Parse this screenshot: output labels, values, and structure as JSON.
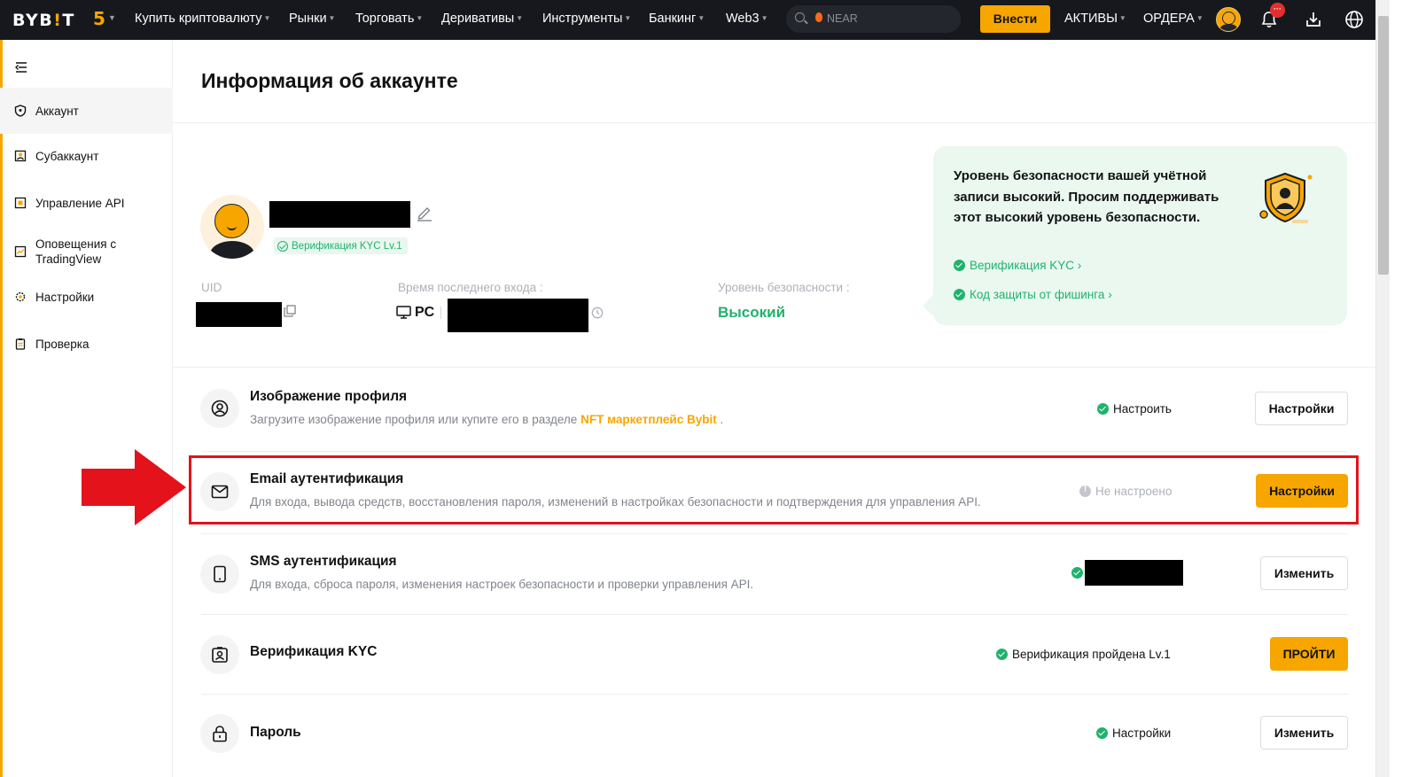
{
  "topbar": {
    "logo_text": "BYB",
    "logo_bang": "!",
    "logo_tail": "T",
    "anniversary": "5",
    "nav": [
      {
        "label": "Купить криптовалюту"
      },
      {
        "label": "Рынки"
      },
      {
        "label": "Торговать"
      },
      {
        "label": "Деривативы"
      },
      {
        "label": "Инструменты"
      },
      {
        "label": "Банкинг"
      },
      {
        "label": "Web3"
      }
    ],
    "search_placeholder": "NEAR",
    "deposit_label": "Внести",
    "assets_label": "АКТИВЫ",
    "orders_label": "ОРДЕРА",
    "notification_badge": "···"
  },
  "sidebar": {
    "items": [
      {
        "label": "Аккаунт",
        "icon": "shield-icon"
      },
      {
        "label": "Субаккаунт",
        "icon": "subaccount-icon"
      },
      {
        "label": "Управление API",
        "icon": "api-icon"
      },
      {
        "label": "Оповещения с TradingView",
        "icon": "tradingview-icon"
      },
      {
        "label": "Настройки",
        "icon": "gear-icon"
      },
      {
        "label": "Проверка",
        "icon": "clipboard-icon"
      }
    ]
  },
  "main": {
    "title": "Информация об аккаунте",
    "kyc_badge": "Верификация KYC Lv.1",
    "uid_label": "UID",
    "last_login_label": "Время последнего входа :",
    "device": "PC",
    "security_level_label": "Уровень безопасности :",
    "security_level_value": "Высокий"
  },
  "security_card": {
    "title": "Уровень безопасности вашей учётной записи высокий. Просим поддерживать этот высокий уровень безопасности.",
    "links": [
      "Верификация KYC ›",
      "Код защиты от фишинга ›"
    ]
  },
  "rows": [
    {
      "title": "Изображение профиля",
      "desc": "Загрузите изображение профиля или купите его в разделе ",
      "desc_link": "NFT маркетплейс Bybit",
      "desc_tail": " .",
      "status": "Настроить",
      "button": "Настройки"
    },
    {
      "title": "Email аутентификация",
      "desc": "Для входа, вывода средств, восстановления пароля, изменений в настройках безопасности и подтверждения для управления API.",
      "status": "Не настроено",
      "button": "Настройки"
    },
    {
      "title": "SMS аутентификация",
      "desc": "Для входа, сброса пароля, изменения настроек безопасности и проверки управления API.",
      "status": "",
      "button": "Изменить"
    },
    {
      "title": "Верификация KYC",
      "status": "Верификация пройдена Lv.1",
      "button": "ПРОЙТИ"
    },
    {
      "title": "Пароль",
      "status": "Настройки",
      "button": "Изменить"
    }
  ],
  "colors": {
    "brand": "#f7a600",
    "success": "#20b26c",
    "topbar_bg": "#17181e",
    "annotation": "#e3121b"
  }
}
